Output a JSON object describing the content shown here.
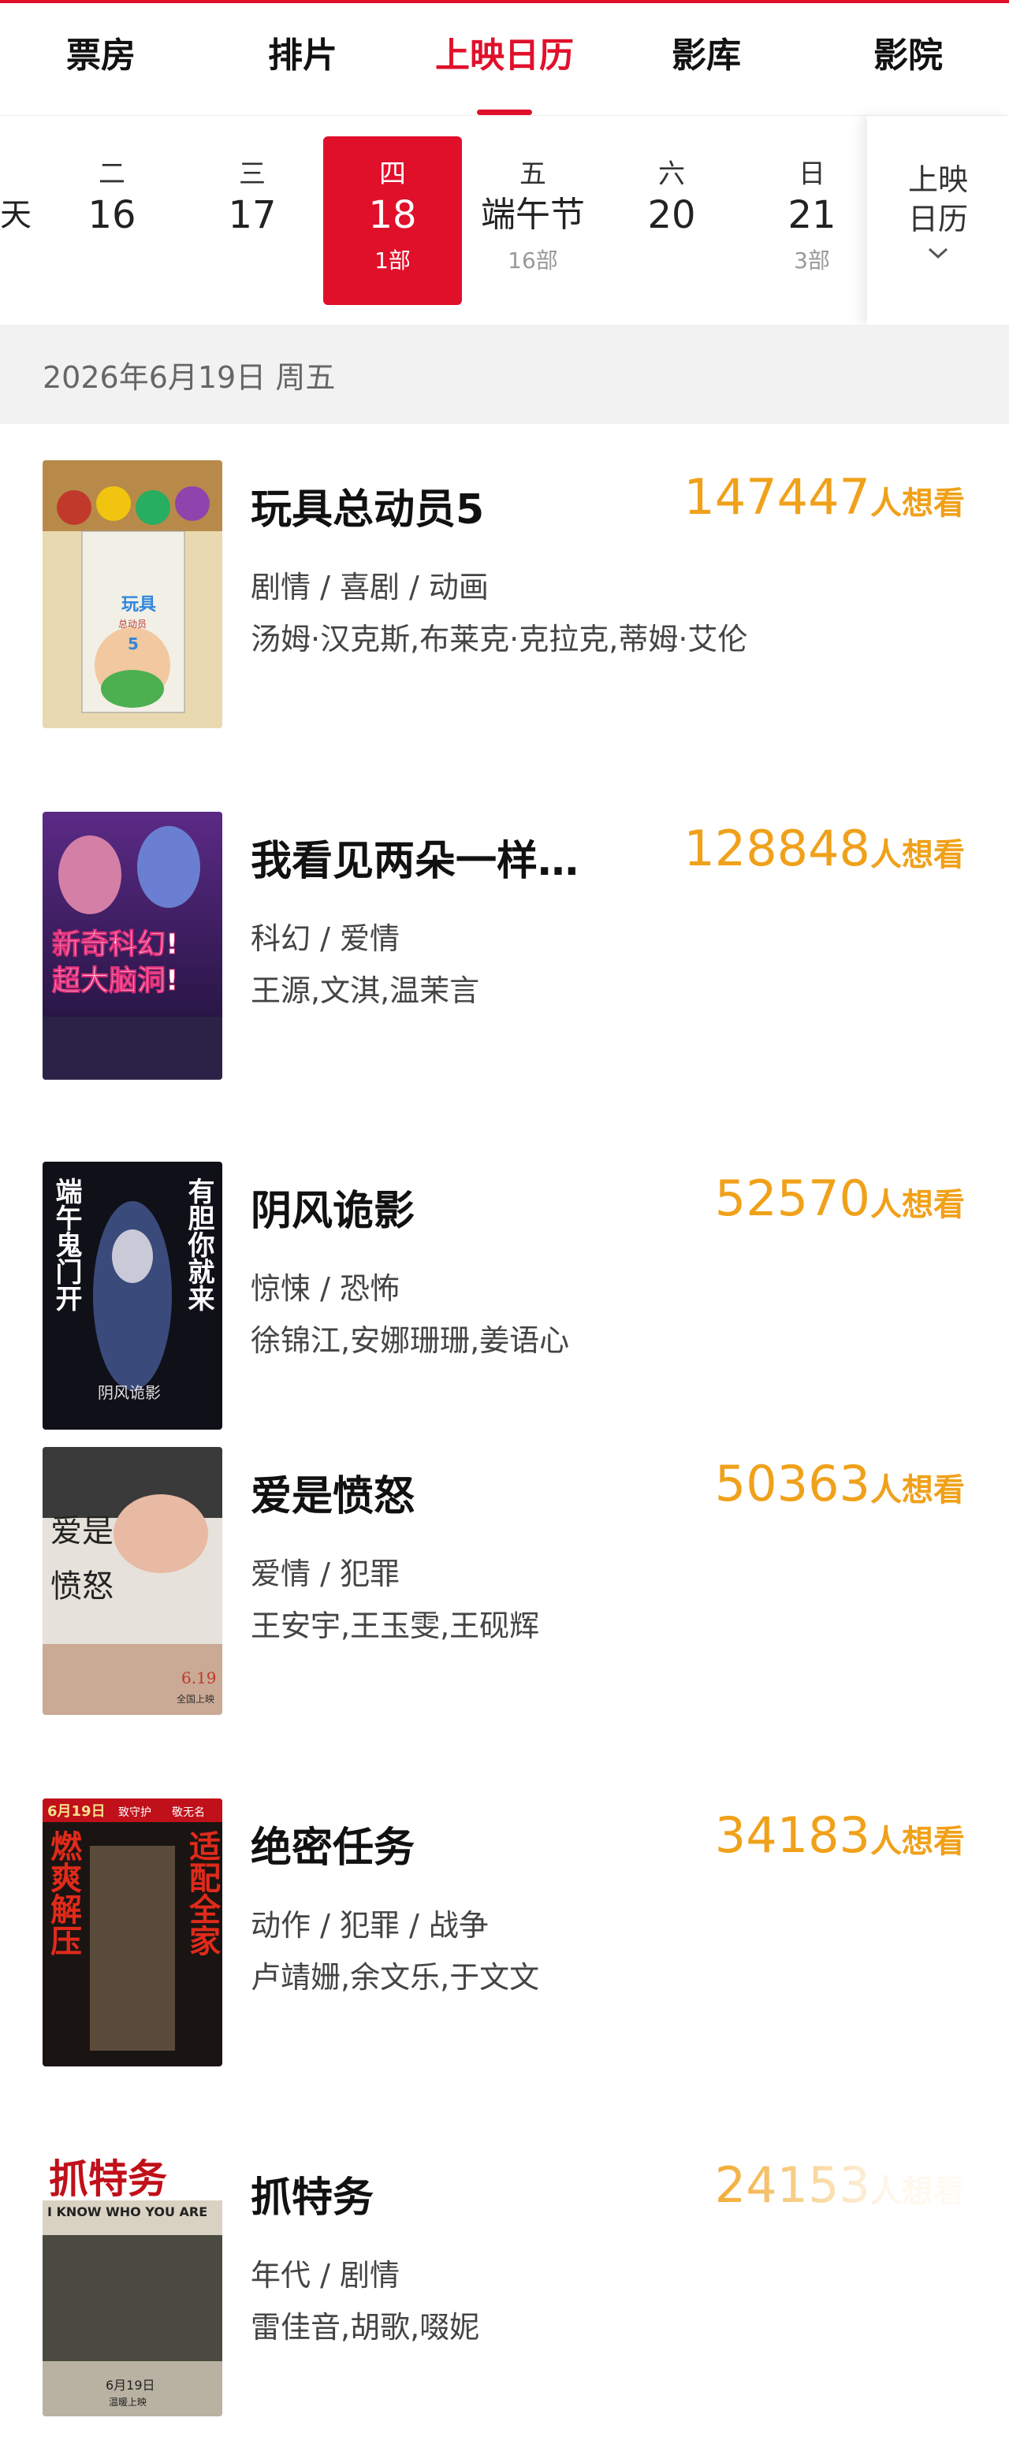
{
  "tabs": [
    "票房",
    "排片",
    "上映日历",
    "影库",
    "影院"
  ],
  "dates": [
    {
      "weekday": "",
      "date": "天",
      "count": ""
    },
    {
      "weekday": "二",
      "date": "16",
      "count": ""
    },
    {
      "weekday": "三",
      "date": "17",
      "count": ""
    },
    {
      "weekday": "四",
      "date": "18",
      "count": "1部"
    },
    {
      "weekday": "五",
      "date": "端午节",
      "count": "16部"
    },
    {
      "weekday": "六",
      "date": "20",
      "count": ""
    },
    {
      "weekday": "日",
      "date": "21",
      "count": "3部"
    }
  ],
  "calendar_button": {
    "line1": "上映",
    "line2": "日历"
  },
  "section_header": "2026年6月19日 周五",
  "want_suffix": "人想看",
  "movies": [
    {
      "title": "玩具总动员5",
      "want": "147447",
      "genre": "剧情 / 喜剧 / 动画",
      "cast": "汤姆·汉克斯,布莱克·克拉克,蒂姆·艾伦",
      "poster_text": [
        "玩具",
        "总动员",
        "5"
      ]
    },
    {
      "title": "我看见两朵一样…",
      "want": "128848",
      "genre": "科幻 / 爱情",
      "cast": "王源,文淇,温茉言",
      "poster_text": [
        "新奇科幻!",
        "超大脑洞!"
      ]
    },
    {
      "title": "阴风诡影",
      "want": "52570",
      "genre": "惊悚 / 恐怖",
      "cast": "徐锦江,安娜珊珊,姜语心",
      "poster_text": [
        "端午鬼门开",
        "有胆你就来",
        "阴风诡影"
      ]
    },
    {
      "title": "爱是愤怒",
      "want": "50363",
      "genre": "爱情 / 犯罪",
      "cast": "王安宇,王玉雯,王砚辉",
      "poster_text": [
        "爱是",
        "愤怒",
        "6.19",
        "全国上映"
      ]
    },
    {
      "title": "绝密任务",
      "want": "34183",
      "genre": "动作 / 犯罪 / 战争",
      "cast": "卢靖姗,余文乐,于文文",
      "poster_text": [
        "6月19日",
        "致守护",
        "敬无名",
        "燃爽解压",
        "适配全家"
      ]
    },
    {
      "title": "抓特务",
      "want": "24153",
      "genre": "年代 / 剧情",
      "cast": "雷佳音,胡歌,啜妮",
      "poster_text": [
        "抓特务",
        "I KNOW WHO YOU ARE",
        "6月19日",
        "温暖上映"
      ]
    }
  ],
  "colors": {
    "accent": "#e0102b",
    "want": "#f0a11a",
    "section_bg": "#f2f2f2"
  }
}
